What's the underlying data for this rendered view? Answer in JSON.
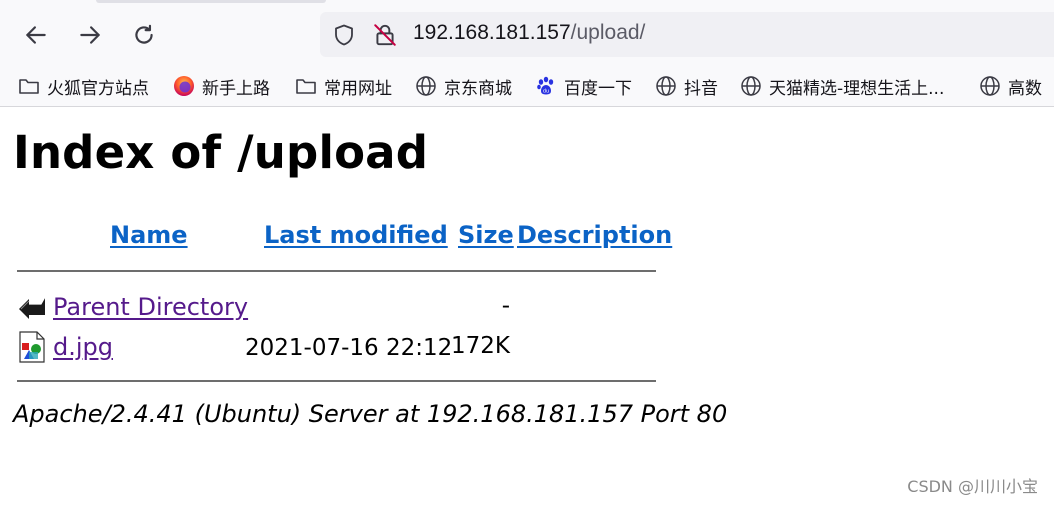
{
  "browser": {
    "url": {
      "host": "192.168.181.157",
      "path": "/upload/"
    },
    "bookmarks": [
      {
        "label": "火狐官方站点",
        "icon": "folder-icon"
      },
      {
        "label": "新手上路",
        "icon": "firefox-icon"
      },
      {
        "label": "常用网址",
        "icon": "folder-icon"
      },
      {
        "label": "京东商城",
        "icon": "globe-icon"
      },
      {
        "label": "百度一下",
        "icon": "baidu-paw-icon"
      },
      {
        "label": "抖音",
        "icon": "globe-icon"
      },
      {
        "label": "天猫精选-理想生活上...",
        "icon": "globe-icon"
      },
      {
        "label": "高数",
        "icon": "globe-icon"
      }
    ]
  },
  "page": {
    "title": "Index of /upload",
    "columns": {
      "name": "Name",
      "modified": "Last modified",
      "size": "Size",
      "description": "Description"
    },
    "rows": [
      {
        "name": "Parent Directory",
        "modified": "",
        "size": "-",
        "icon": "back-arrow-icon"
      },
      {
        "name": "d.jpg",
        "modified": "2021-07-16 22:12",
        "size": "172K",
        "icon": "image-file-icon"
      }
    ],
    "footer": "Apache/2.4.41 (Ubuntu) Server at 192.168.181.157 Port 80"
  },
  "watermark": "CSDN @川川小宝",
  "colors": {
    "link": "#0b63c6",
    "visited_link": "#551a8b",
    "chrome_bg": "#f9f9fb",
    "urlbar_bg": "#f0f0f4"
  }
}
